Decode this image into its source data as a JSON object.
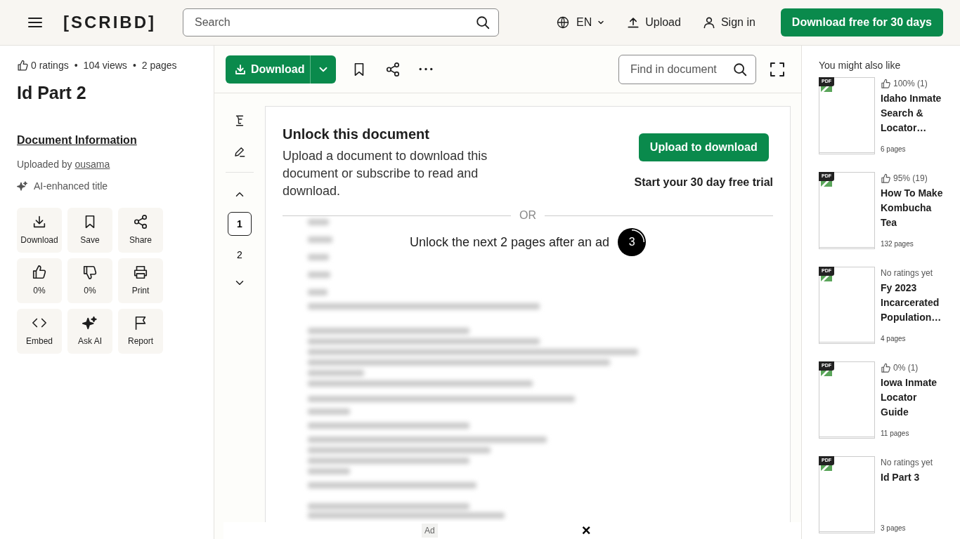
{
  "header": {
    "logo": "[SCRIBD]",
    "search": {
      "placeholder": "Search"
    },
    "language": "EN",
    "upload": "Upload",
    "sign_in": "Sign in",
    "cta": "Download free for 30 days"
  },
  "document": {
    "ratings": "0 ratings",
    "separator": "•",
    "views": "104 views",
    "pages": "2 pages",
    "title": "Id Part 2",
    "info_heading": "Document Information",
    "uploaded_by": "Uploaded by",
    "uploader": "ousama",
    "ai_note": "AI-enhanced title"
  },
  "actions": [
    {
      "label": "Download"
    },
    {
      "label": "Save"
    },
    {
      "label": "Share"
    },
    {
      "label": "0%"
    },
    {
      "label": "0%"
    },
    {
      "label": "Print"
    },
    {
      "label": "Embed"
    },
    {
      "label": "Ask AI"
    },
    {
      "label": "Report"
    }
  ],
  "toolbar": {
    "download": "Download",
    "find": {
      "placeholder": "Find in document"
    }
  },
  "page_nav": [
    {
      "label": "1",
      "selected": true
    },
    {
      "label": "2",
      "selected": false
    }
  ],
  "unlock": {
    "title": "Unlock this document",
    "text": "Upload a document to download this document or subscribe to read and download.",
    "button": "Upload to download",
    "trial": "Start your 30 day free trial",
    "or": "OR",
    "ad_text": "Unlock the next 2 pages after an ad",
    "countdown": "3"
  },
  "ad_bar": {
    "label": "Ad",
    "close": "×"
  },
  "related": {
    "heading": "You might also like",
    "items": [
      {
        "badge": "PDF",
        "kind": "rated",
        "rating": "100% (1)",
        "title": "Idaho Inmate Search & Locator…",
        "pages": "6 pages"
      },
      {
        "badge": "PDF",
        "kind": "rated",
        "rating": "95% (19)",
        "title": "How To Make Kombucha Tea",
        "pages": "132 pages"
      },
      {
        "badge": "PDF",
        "kind": "unrated",
        "rating": "No ratings yet",
        "title": "Fy 2023 Incarcerated Population…",
        "pages": "4 pages"
      },
      {
        "badge": "PDF",
        "kind": "rated",
        "rating": "0% (1)",
        "title": "Iowa Inmate Locator Guide",
        "pages": "11 pages"
      },
      {
        "badge": "PDF",
        "kind": "unrated",
        "rating": "No ratings yet",
        "title": "Id Part 3",
        "pages": "3 pages"
      }
    ]
  }
}
